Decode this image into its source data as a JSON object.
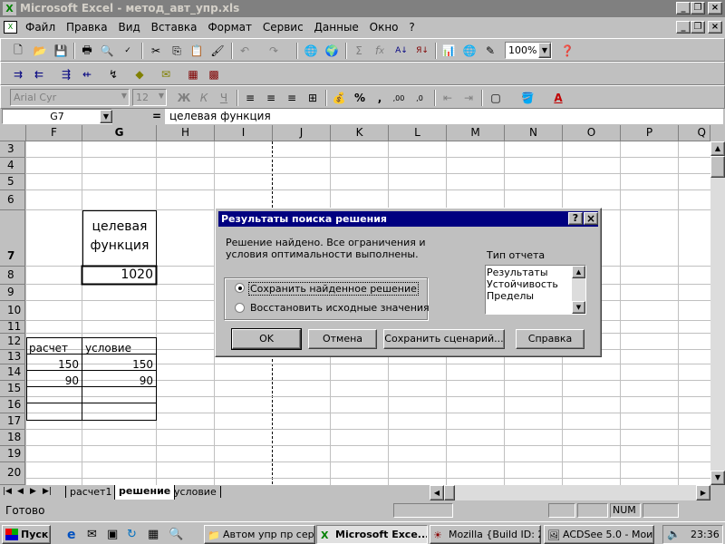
{
  "window": {
    "title": "Microsoft Excel - метод_авт_упр.xls"
  },
  "menu": {
    "items": [
      "Файл",
      "Правка",
      "Вид",
      "Вставка",
      "Формат",
      "Сервис",
      "Данные",
      "Окно",
      "?"
    ]
  },
  "toolbar": {
    "zoom": "100%",
    "font": "Arial Cyr",
    "font_size": "12"
  },
  "formula_bar": {
    "name_box": "G7",
    "equals": "=",
    "content": "целевая функция"
  },
  "columns": [
    "F",
    "G",
    "H",
    "I",
    "J",
    "K",
    "L",
    "M",
    "N",
    "O",
    "P",
    "Q"
  ],
  "rows": [
    "3",
    "4",
    "5",
    "6",
    "7",
    "8",
    "9",
    "10",
    "11",
    "12",
    "13",
    "14",
    "15",
    "16",
    "17",
    "18",
    "19",
    "20"
  ],
  "cells": {
    "g7_line1": "целевая",
    "g7_line2": "функция",
    "g8": "1020",
    "f12": "расчет",
    "g12": "условие",
    "f13": "150",
    "g13": "150",
    "f14": "90",
    "g14": "90"
  },
  "dialog": {
    "title": "Результаты поиска решения",
    "help_btn": "?",
    "close_btn": "×",
    "message": "Решение найдено. Все ограничения и условия оптимальности выполнены.",
    "report_label": "Тип отчета",
    "reports": [
      "Результаты",
      "Устойчивость",
      "Пределы"
    ],
    "radio_keep": "Сохранить найденное решение",
    "radio_restore": "Восстановить исходные значения",
    "ok": "OK",
    "cancel": "Отмена",
    "save_scenario": "Сохранить сценарий...",
    "help": "Справка"
  },
  "sheets": [
    "расчет1",
    "решение",
    "условие"
  ],
  "status": {
    "text": "Готово",
    "num": "NUM"
  },
  "taskbar": {
    "start": "Пуск",
    "tasks": [
      "Автом упр пр серв",
      "Microsoft Exce...",
      "Mozilla {Build ID: 2...",
      "ACDSee 5.0 - Мои..."
    ],
    "clock": "23:36"
  }
}
